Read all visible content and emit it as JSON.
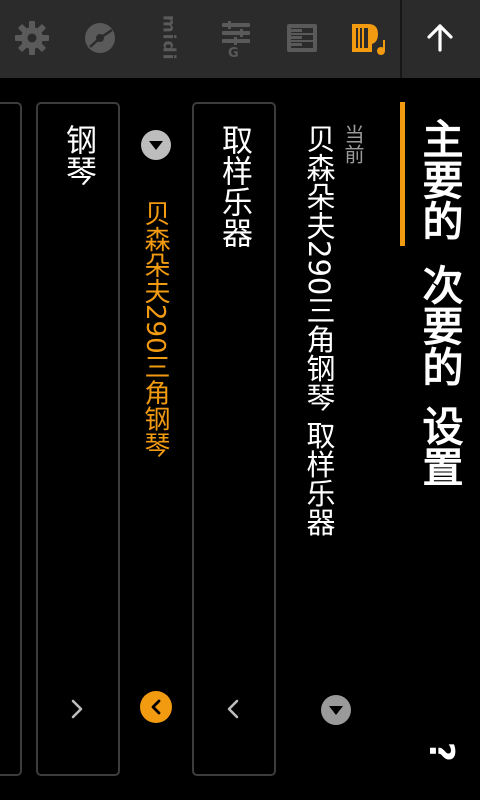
{
  "toolbar": {
    "icons": [
      "gear-icon",
      "disc-icon",
      "midi-icon",
      "mixer-g-icon",
      "piano-keys-icon",
      "instrument-icon",
      "up-arrow-icon"
    ],
    "midi_label": "midi",
    "mixer_letter": "G",
    "active_color": "#f29b11",
    "inactive_color": "#5a5a5a"
  },
  "tabs": {
    "main": "主要的",
    "secondary": "次要的",
    "settings": "设置",
    "active": "main"
  },
  "current": {
    "label": "当前",
    "value": "贝森朵夫290三角钢琴 取样乐器"
  },
  "panels": {
    "sampled": {
      "label": "取样乐器"
    },
    "piano": {
      "label": "钢琴"
    },
    "selected_instrument": "贝森朵夫290三角钢琴"
  },
  "help": "?",
  "colors": {
    "accent": "#f29b11",
    "toolbar": "#2b2b2b",
    "background": "#000000"
  }
}
